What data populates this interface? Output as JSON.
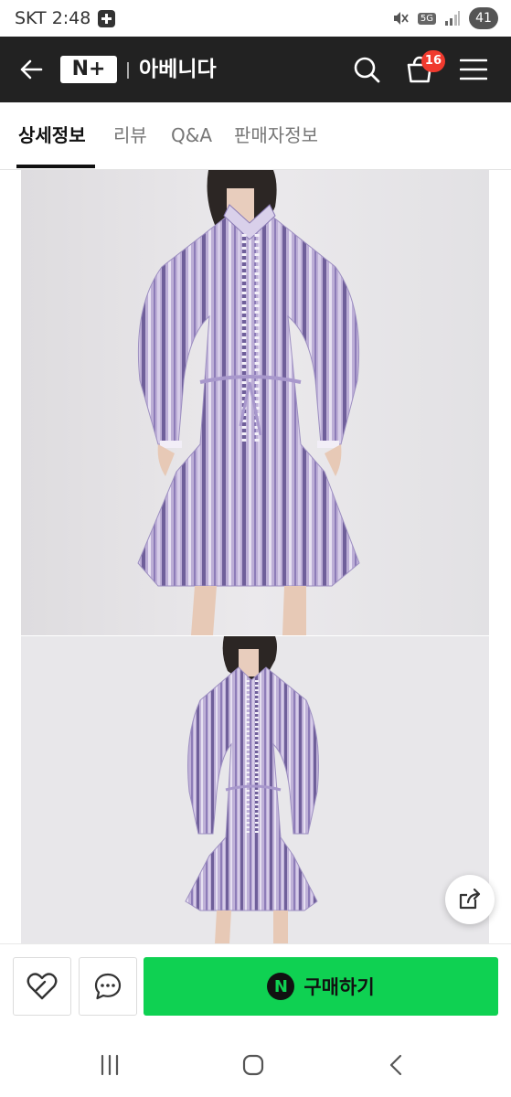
{
  "status_bar": {
    "carrier_time": "SKT 2:48",
    "network": "5G",
    "battery": "41"
  },
  "header": {
    "logo_text": "N+",
    "store_name": "아베니다",
    "cart_count": "16"
  },
  "tabs": [
    {
      "label": "상세정보",
      "active": true
    },
    {
      "label": "리뷰",
      "active": false
    },
    {
      "label": "Q&A",
      "active": false
    },
    {
      "label": "판매자정보",
      "active": false
    }
  ],
  "buy_bar": {
    "buy_label": "구매하기",
    "buy_icon_text": "N"
  },
  "colors": {
    "header_bg": "#222222",
    "buy_green": "#0fd152",
    "badge_red": "#f03a2e"
  },
  "icons": [
    "back-arrow-icon",
    "search-icon",
    "shopping-bag-icon",
    "hamburger-menu-icon",
    "share-icon",
    "heart-icon",
    "chat-bubble-icon"
  ]
}
